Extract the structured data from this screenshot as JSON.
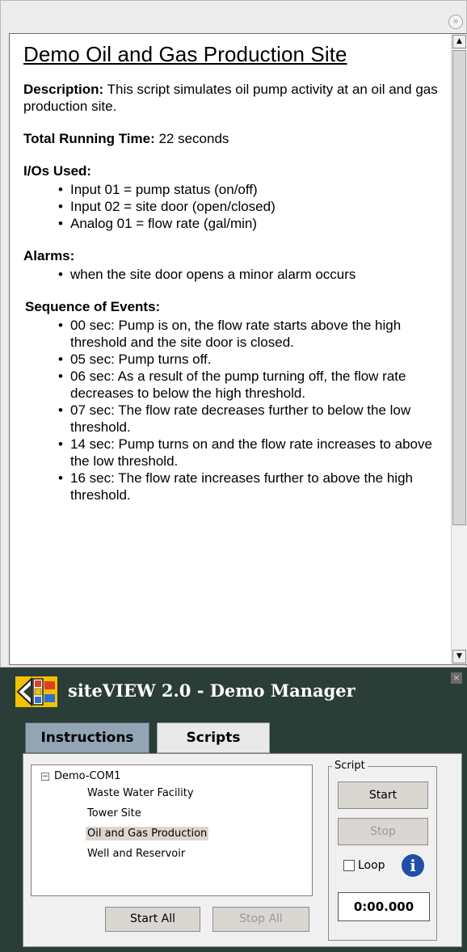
{
  "document": {
    "title": "Demo Oil and Gas Production Site",
    "description_label": "Description:",
    "description_text": " This script simulates oil pump activity at an oil and gas production site.",
    "running_time_label": "Total Running Time:",
    "running_time_text": " 22 seconds",
    "ios_heading": "I/Os Used:",
    "ios": [
      "Input 01 = pump status (on/off)",
      "Input 02 = site door (open/closed)",
      "Analog 01 = flow rate (gal/min)"
    ],
    "alarms_heading": "Alarms:",
    "alarms": [
      "when the site door opens a minor alarm occurs"
    ],
    "events_heading": "Sequence of Events:",
    "events": [
      "00 sec: Pump is on, the flow rate starts above the high threshold and the site door is closed.",
      "05 sec: Pump turns off.",
      "06 sec: As a result of the pump turning off, the flow rate decreases to below the high threshold.",
      "07 sec: The flow rate decreases further to below the low threshold.",
      "14 sec: Pump turns on and the flow rate increases to above the low threshold.",
      "16 sec: The flow rate increases further to above the high threshold."
    ]
  },
  "manager": {
    "title": "siteVIEW 2.0 - Demo Manager",
    "tabs": [
      "Instructions",
      "Scripts"
    ],
    "tree": {
      "root": "Demo-COM1",
      "expander": "−",
      "items": [
        "Waste Water Facility",
        "Tower Site",
        "Oil and Gas Production",
        "Well and Reservoir"
      ],
      "selected": "Oil and Gas Production"
    },
    "start_all": "Start All",
    "stop_all": "Stop All",
    "script_group": {
      "legend": "Script",
      "start": "Start",
      "stop": "Stop",
      "loop": "Loop",
      "timer": "0:00.000"
    }
  },
  "icons": {
    "collapse": "double-chevron-down-icon",
    "close": "close-icon",
    "info": "info-icon",
    "logo": "siteview-logo"
  },
  "colors": {
    "panel_bg": "#2b3d37",
    "active_tab": "#93a5b5",
    "selected_item": "#ddd6d0"
  }
}
